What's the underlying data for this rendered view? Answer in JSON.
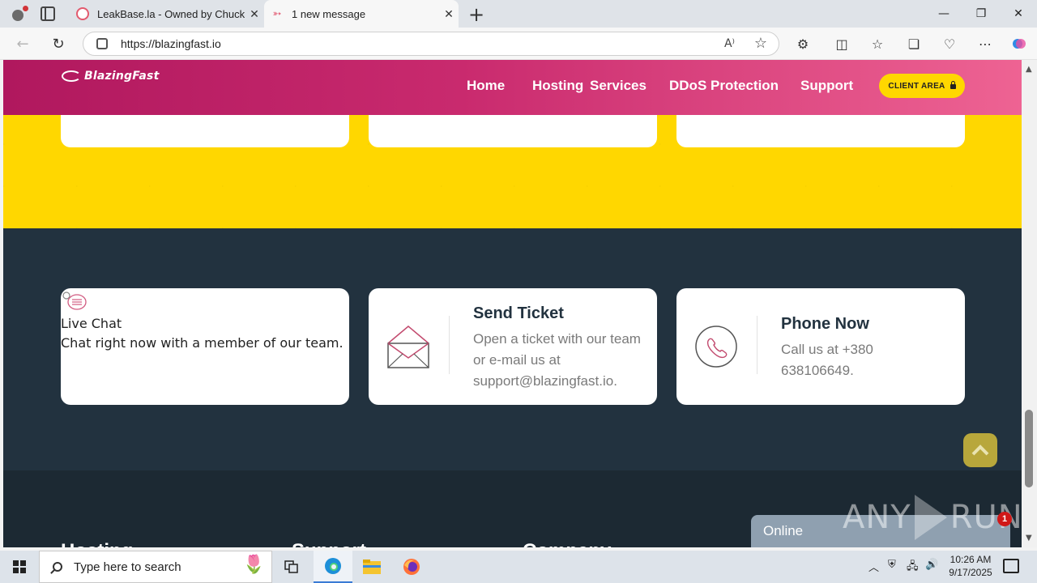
{
  "browser": {
    "tabs": [
      {
        "title": "LeakBase.la - Owned by Chucky",
        "active": false
      },
      {
        "title": "1 new message",
        "active": true
      }
    ],
    "url": "https://blazingfast.io",
    "new_tab_label": "+",
    "read_aloud_label": "A⁾"
  },
  "site": {
    "logo_text": "BlazingFast",
    "nav": {
      "home": "Home",
      "hosting": "Hosting",
      "services": "Services",
      "ddos": "DDoS Protection",
      "support": "Support",
      "client_area": "CLIENT AREA"
    },
    "contact": {
      "live_chat": {
        "title": "Live Chat",
        "text": "Chat right now with a member of our team."
      },
      "send_ticket": {
        "title": "Send Ticket",
        "text": "Open a ticket with our team or e-mail us at support@blazingfast.io."
      },
      "phone": {
        "title": "Phone Now",
        "text": "Call us at +380 638106649."
      }
    },
    "footer_headings": [
      "Hosting",
      "Support",
      "Company"
    ],
    "chat_widget": {
      "status": "Online",
      "badge_count": "1"
    },
    "watermark": {
      "left": "ANY",
      "right": "RUN"
    }
  },
  "taskbar": {
    "search_placeholder": "Type here to search",
    "time": "10:26 AM",
    "date": "9/17/2025"
  },
  "colors": {
    "nav_gradient_start": "#b0185e",
    "nav_gradient_end": "#ee6393",
    "yellow": "#ffd700",
    "dark": "#22323f",
    "accent_pink": "#c24a6e"
  }
}
